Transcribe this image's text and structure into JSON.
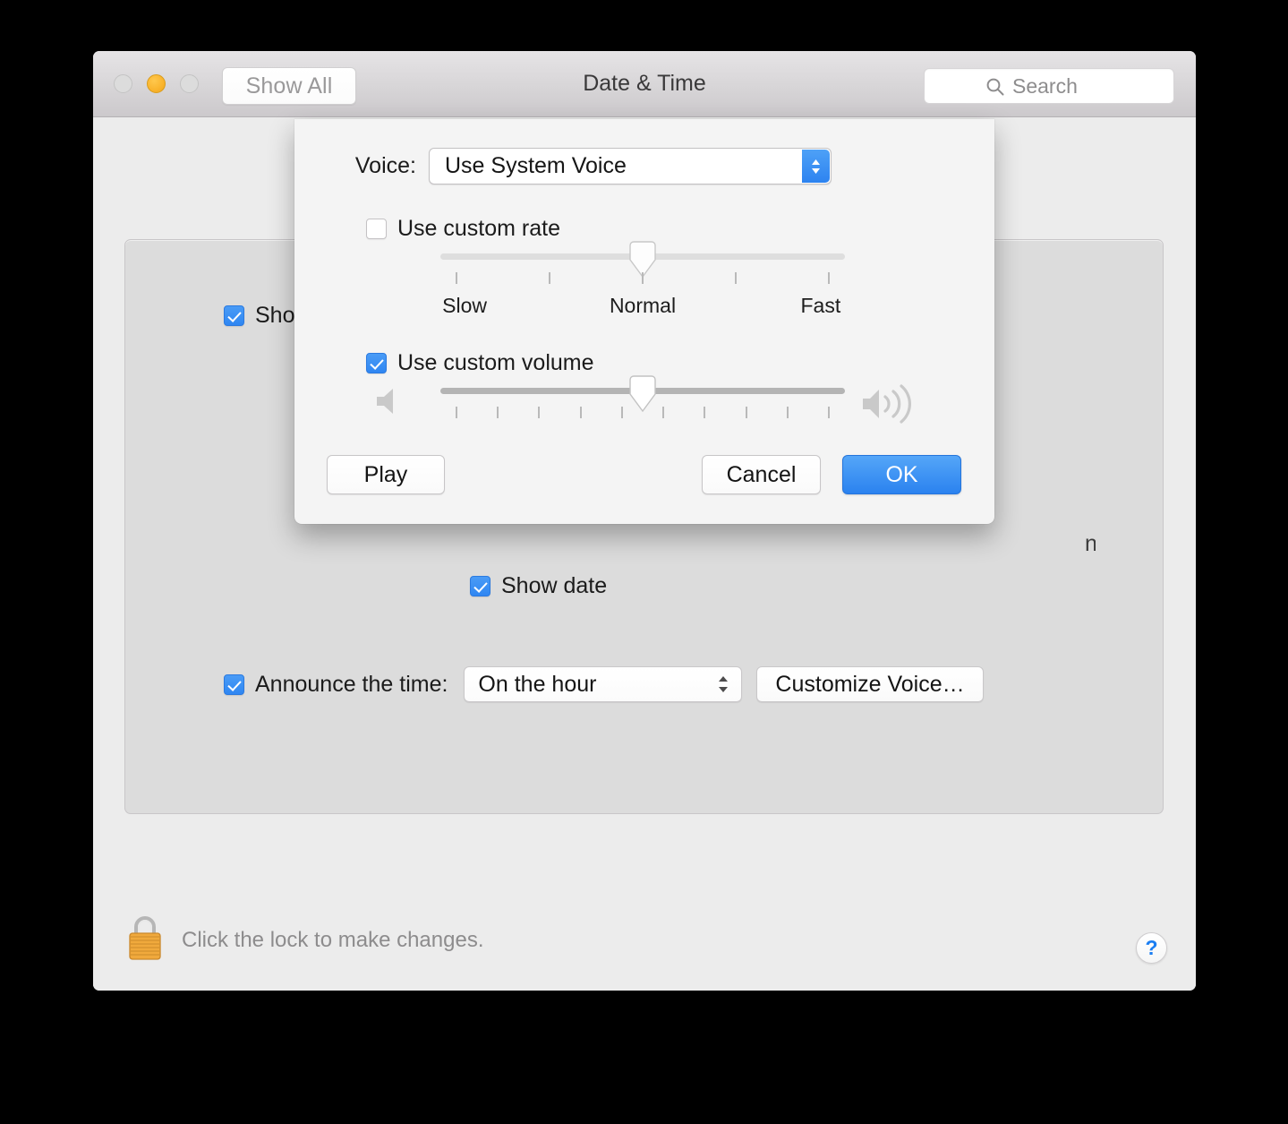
{
  "window": {
    "title": "Date & Time",
    "show_all_label": "Show All",
    "traffic_lights": [
      "close",
      "minimize",
      "zoom"
    ],
    "accent_color": "#2d83f0",
    "minimize_color": "#f9b32c"
  },
  "search": {
    "placeholder": "Search",
    "icon": "search-icon"
  },
  "background_panel": {
    "show_clock_label": "Show",
    "show_clock_checked": true,
    "show_date_label": "Show date",
    "show_date_checked": true,
    "announce": {
      "checkbox_label": "Announce the time:",
      "checked": true,
      "interval_value": "On the hour",
      "customize_button": "Customize Voice…"
    },
    "occluded_fragment": "n"
  },
  "footer": {
    "lock_icon": "lock-closed-icon",
    "lock_text": "Click the lock to make changes.",
    "help_label": "?"
  },
  "sheet": {
    "voice": {
      "label": "Voice:",
      "value": "Use System Voice"
    },
    "rate": {
      "checkbox_label": "Use custom rate",
      "checked": false,
      "value_percent": 50,
      "tick_count": 5,
      "scale_labels": [
        "Slow",
        "Normal",
        "Fast"
      ],
      "scale_positions": [
        6,
        50,
        94
      ]
    },
    "volume": {
      "checkbox_label": "Use custom volume",
      "checked": true,
      "value_percent": 50,
      "tick_count": 10,
      "low_icon": "speaker-low-icon",
      "high_icon": "speaker-high-icon"
    },
    "buttons": {
      "play": "Play",
      "cancel": "Cancel",
      "ok": "OK"
    }
  }
}
